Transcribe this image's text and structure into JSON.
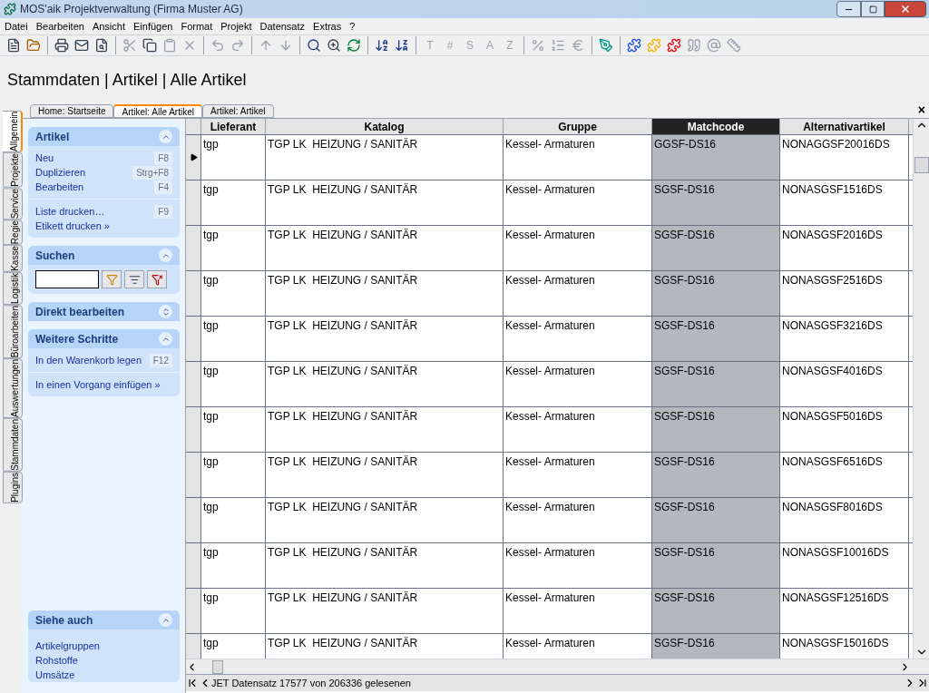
{
  "window": {
    "title": "MOS'aik Projektverwaltung (Firma Muster AG)"
  },
  "menu": [
    "Datei",
    "Bearbeiten",
    "Ansicht",
    "Einfügen",
    "Format",
    "Projekt",
    "Datensatz",
    "Extras",
    "?"
  ],
  "toolbar_glyphs": [
    "T",
    "#",
    "S",
    "A",
    "Z"
  ],
  "heading": "Stammdaten | Artikel | Alle Artikel",
  "side_tabs": [
    {
      "label": "Allgemein",
      "selected": true
    },
    {
      "label": "Projekte",
      "selected": false
    },
    {
      "label": "Service",
      "selected": false
    },
    {
      "label": "Regie",
      "selected": false
    },
    {
      "label": "Kasse",
      "selected": false
    },
    {
      "label": "Logistik",
      "selected": false
    },
    {
      "label": "Büroarbeiten",
      "selected": false
    },
    {
      "label": "Auswertungen",
      "selected": false
    },
    {
      "label": "Stammdaten",
      "selected": false
    },
    {
      "label": "Plugins",
      "selected": false
    }
  ],
  "doc_tabs": [
    {
      "label": "Home: Startseite",
      "selected": false
    },
    {
      "label": "Artikel: Alle Artikel",
      "selected": true
    },
    {
      "label": "Artikel: Artikel",
      "selected": false
    }
  ],
  "close_glyph": "×",
  "panels": [
    {
      "kind": "links",
      "title": "Artikel",
      "expanded": true,
      "groups": [
        [
          {
            "label": "Neu",
            "shortcut": "F8"
          },
          {
            "label": "Duplizieren",
            "shortcut": "Strg+F8"
          },
          {
            "label": "Bearbeiten",
            "shortcut": "F4"
          }
        ],
        [
          {
            "label": "Liste drucken…",
            "shortcut": "F9"
          },
          {
            "label": "Etikett drucken »"
          }
        ]
      ]
    },
    {
      "kind": "search",
      "title": "Suchen",
      "expanded": true
    },
    {
      "kind": "links",
      "title": "Direkt bearbeiten",
      "expanded": false
    },
    {
      "kind": "links",
      "title": "Weitere Schritte",
      "expanded": true,
      "groups": [
        [
          {
            "label": "In den Warenkorb legen",
            "shortcut": "F12"
          }
        ],
        [
          {
            "label": "In einen Vorgang einfügen »"
          }
        ]
      ]
    }
  ],
  "bottom_panel": {
    "title": "Siehe auch",
    "expanded": true,
    "links": [
      "Artikelgruppen",
      "Rohstoffe",
      "Umsätze"
    ]
  },
  "table": {
    "columns": [
      {
        "label": "Lieferant",
        "selected": false
      },
      {
        "label": "Katalog",
        "selected": false
      },
      {
        "label": "Gruppe",
        "selected": false
      },
      {
        "label": "Matchcode",
        "selected": true
      },
      {
        "label": "Alternativartikel",
        "selected": false
      }
    ],
    "rows": [
      {
        "selected": true,
        "cells": [
          "tgp",
          "TGP LK  HEIZUNG / SANITÄR",
          "Kessel- Armaturen",
          "GGSF-DS16",
          "NONAGGSF20016DS"
        ]
      },
      {
        "selected": false,
        "cells": [
          "tgp",
          "TGP LK  HEIZUNG / SANITÄR",
          "Kessel- Armaturen",
          "SGSF-DS16",
          "NONASGSF1516DS"
        ]
      },
      {
        "selected": false,
        "cells": [
          "tgp",
          "TGP LK  HEIZUNG / SANITÄR",
          "Kessel- Armaturen",
          "SGSF-DS16",
          "NONASGSF2016DS"
        ]
      },
      {
        "selected": false,
        "cells": [
          "tgp",
          "TGP LK  HEIZUNG / SANITÄR",
          "Kessel- Armaturen",
          "SGSF-DS16",
          "NONASGSF2516DS"
        ]
      },
      {
        "selected": false,
        "cells": [
          "tgp",
          "TGP LK  HEIZUNG / SANITÄR",
          "Kessel- Armaturen",
          "SGSF-DS16",
          "NONASGSF3216DS"
        ]
      },
      {
        "selected": false,
        "cells": [
          "tgp",
          "TGP LK  HEIZUNG / SANITÄR",
          "Kessel- Armaturen",
          "SGSF-DS16",
          "NONASGSF4016DS"
        ]
      },
      {
        "selected": false,
        "cells": [
          "tgp",
          "TGP LK  HEIZUNG / SANITÄR",
          "Kessel- Armaturen",
          "SGSF-DS16",
          "NONASGSF5016DS"
        ]
      },
      {
        "selected": false,
        "cells": [
          "tgp",
          "TGP LK  HEIZUNG / SANITÄR",
          "Kessel- Armaturen",
          "SGSF-DS16",
          "NONASGSF6516DS"
        ]
      },
      {
        "selected": false,
        "cells": [
          "tgp",
          "TGP LK  HEIZUNG / SANITÄR",
          "Kessel- Armaturen",
          "SGSF-DS16",
          "NONASGSF8016DS"
        ]
      },
      {
        "selected": false,
        "cells": [
          "tgp",
          "TGP LK  HEIZUNG / SANITÄR",
          "Kessel- Armaturen",
          "SGSF-DS16",
          "NONASGSF10016DS"
        ]
      },
      {
        "selected": false,
        "cells": [
          "tgp",
          "TGP LK  HEIZUNG / SANITÄR",
          "Kessel- Armaturen",
          "SGSF-DS16",
          "NONASGSF12516DS"
        ]
      },
      {
        "selected": false,
        "cells": [
          "tgp",
          "TGP LK  HEIZUNG / SANITÄR",
          "Kessel- Armaturen",
          "SGSF-DS16",
          "NONASGSF15016DS"
        ]
      }
    ]
  },
  "status_bar": "JET Datensatz 17577 von 206336 gelesenen"
}
